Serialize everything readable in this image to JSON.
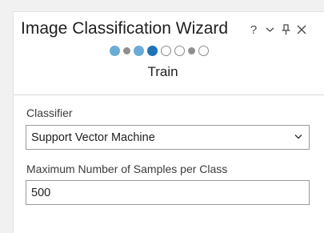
{
  "pane": {
    "title": "Image Classification Wizard"
  },
  "window_controls": [
    {
      "name": "help-button",
      "icon": "question-icon",
      "glyph": "?"
    },
    {
      "name": "options-button",
      "icon": "chevron-down-icon",
      "glyph": ""
    },
    {
      "name": "pin-button",
      "icon": "pin-icon",
      "glyph": ""
    },
    {
      "name": "close-button",
      "icon": "close-icon",
      "glyph": ""
    }
  ],
  "wizard": {
    "steps": [
      {
        "status": "completed",
        "size": "large"
      },
      {
        "status": "completed-sub",
        "size": "small"
      },
      {
        "status": "completed",
        "size": "large"
      },
      {
        "status": "current",
        "size": "large"
      },
      {
        "status": "pending",
        "size": "large"
      },
      {
        "status": "pending",
        "size": "large"
      },
      {
        "status": "completed-sub-gray",
        "size": "small"
      },
      {
        "status": "pending",
        "size": "large"
      }
    ],
    "current_step_label": "Train"
  },
  "form": {
    "classifier_label": "Classifier",
    "classifier_value": "Support Vector Machine",
    "max_samples_label": "Maximum Number of Samples per Class",
    "max_samples_value": "500"
  },
  "colors": {
    "step_completed": "#6aaad6",
    "step_current": "#1f73b7",
    "step_small": "#8f8f8f",
    "background": "#f1f1f1"
  }
}
